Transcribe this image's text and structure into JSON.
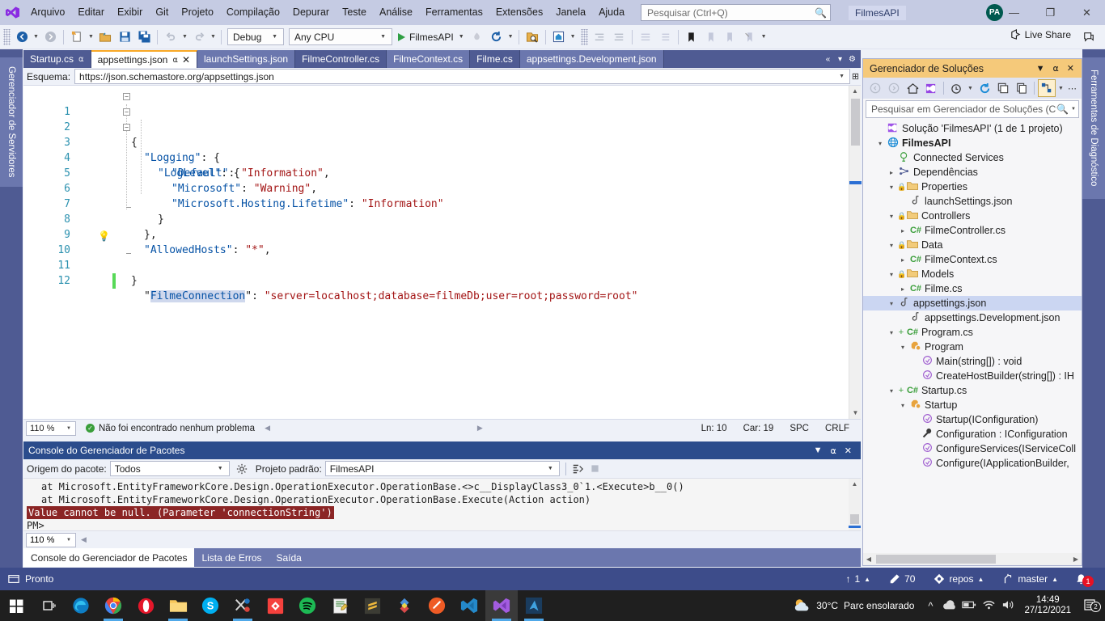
{
  "titlebar": {
    "menus": [
      "Arquivo",
      "Editar",
      "Exibir",
      "Git",
      "Projeto",
      "Compilação",
      "Depurar",
      "Teste",
      "Análise",
      "Ferramentas",
      "Extensões",
      "Janela",
      "Ajuda"
    ],
    "search_placeholder": "Pesquisar (Ctrl+Q)",
    "solution_chip": "FilmesAPI",
    "avatar_initials": "PA",
    "minimize": "—",
    "restore": "❐",
    "close": "✕"
  },
  "toolbar": {
    "config": "Debug",
    "platform": "Any CPU",
    "run_target": "FilmesAPI",
    "live_share": "Live Share"
  },
  "docks": {
    "left_tab": "Gerenciador de Servidores",
    "right_tab": "Ferramentas de Diagnóstico"
  },
  "editor": {
    "tabs": [
      {
        "label": "Startup.cs",
        "state": "inactive",
        "pinned": true
      },
      {
        "label": "appsettings.json",
        "state": "active",
        "pinned": true,
        "closable": true
      },
      {
        "label": "launchSettings.json",
        "state": "inactive2"
      },
      {
        "label": "FilmeController.cs",
        "state": "inactive"
      },
      {
        "label": "FilmeContext.cs",
        "state": "inactive2"
      },
      {
        "label": "Filme.cs",
        "state": "inactive"
      },
      {
        "label": "appsettings.Development.json",
        "state": "inactive2"
      }
    ],
    "schema_label": "Esquema:",
    "schema_value": "https://json.schemastore.org/appsettings.json",
    "lines": [
      {
        "n": "1",
        "indent": 0,
        "fold": "minus",
        "text": "{"
      },
      {
        "n": "2",
        "indent": 1,
        "fold": "minus",
        "text": "\"Logging\": {"
      },
      {
        "n": "3",
        "indent": 2,
        "fold": "minus",
        "text": "\"LogLevel\": {"
      },
      {
        "n": "4",
        "indent": 3,
        "text": "\"Default\": \"Information\","
      },
      {
        "n": "5",
        "indent": 3,
        "text": "\"Microsoft\": \"Warning\","
      },
      {
        "n": "6",
        "indent": 3,
        "text": "\"Microsoft.Hosting.Lifetime\": \"Information\""
      },
      {
        "n": "7",
        "indent": 2,
        "text": "}"
      },
      {
        "n": "8",
        "indent": 1,
        "text": "},"
      },
      {
        "n": "9",
        "indent": 1,
        "text": "\"AllowedHosts\": \"*\","
      },
      {
        "n": "10",
        "indent": 1,
        "text": "\"FilmeConnection\": \"server=localhost;database=filmeDb;user=root;password=root\"",
        "bulb": true,
        "changed": true
      },
      {
        "n": "11",
        "indent": 0,
        "text": "}"
      },
      {
        "n": "12",
        "indent": 0,
        "text": ""
      }
    ],
    "status": {
      "zoom": "110 %",
      "problems": "Não foi encontrado nenhum problema",
      "line": "Ln: 10",
      "col": "Car: 19",
      "spaces": "SPC",
      "eol": "CRLF"
    }
  },
  "package_console": {
    "title": "Console do Gerenciador de Pacotes",
    "source_label": "Origem do pacote:",
    "source_value": "Todos",
    "project_label": "Projeto padrão:",
    "project_value": "FilmesAPI",
    "output": [
      {
        "text": "at Microsoft.EntityFrameworkCore.Design.OperationExecutor.OperationBase.<>c__DisplayClass3_0`1.<Execute>b__0()",
        "type": "normal"
      },
      {
        "text": "at Microsoft.EntityFrameworkCore.Design.OperationExecutor.OperationBase.Execute(Action action)",
        "type": "normal"
      },
      {
        "text": "Value cannot be null. (Parameter 'connectionString')",
        "type": "error"
      },
      {
        "text": "PM>",
        "type": "prompt"
      }
    ],
    "zoom": "110 %",
    "tabs": [
      {
        "label": "Console do Gerenciador de Pacotes",
        "active": true
      },
      {
        "label": "Lista de Erros",
        "active": false
      },
      {
        "label": "Saída",
        "active": false
      }
    ]
  },
  "solution_explorer": {
    "title": "Gerenciador de Soluções",
    "search_placeholder": "Pesquisar em Gerenciador de Soluções (Ctrl",
    "tree": [
      {
        "indent": 0,
        "twisty": "",
        "icon": "solution",
        "label": "Solução 'FilmesAPI' (1 de 1 projeto)"
      },
      {
        "indent": 0,
        "twisty": "open",
        "icon": "project",
        "label": "FilmesAPI",
        "bold": true
      },
      {
        "indent": 1,
        "twisty": "",
        "icon": "services",
        "label": "Connected Services"
      },
      {
        "indent": 1,
        "twisty": "closed",
        "icon": "deps",
        "label": "Dependências"
      },
      {
        "indent": 1,
        "twisty": "open",
        "icon": "folder",
        "label": "Properties",
        "lock": true
      },
      {
        "indent": 2,
        "twisty": "",
        "icon": "json",
        "label": "launchSettings.json"
      },
      {
        "indent": 1,
        "twisty": "open",
        "icon": "folder",
        "label": "Controllers",
        "lock": true
      },
      {
        "indent": 2,
        "twisty": "closed",
        "icon": "cs",
        "label": "FilmeController.cs"
      },
      {
        "indent": 1,
        "twisty": "open",
        "icon": "folder",
        "label": "Data",
        "lock": true
      },
      {
        "indent": 2,
        "twisty": "closed",
        "icon": "cs",
        "label": "FilmeContext.cs"
      },
      {
        "indent": 1,
        "twisty": "open",
        "icon": "folder",
        "label": "Models",
        "lock": true
      },
      {
        "indent": 2,
        "twisty": "closed",
        "icon": "cs",
        "label": "Filme.cs"
      },
      {
        "indent": 1,
        "twisty": "open",
        "icon": "json",
        "label": "appsettings.json",
        "selected": true
      },
      {
        "indent": 2,
        "twisty": "",
        "icon": "json",
        "label": "appsettings.Development.json"
      },
      {
        "indent": 1,
        "twisty": "open",
        "icon": "cs",
        "label": "Program.cs",
        "plus": true
      },
      {
        "indent": 2,
        "twisty": "open",
        "icon": "class",
        "label": "Program"
      },
      {
        "indent": 3,
        "twisty": "",
        "icon": "method",
        "label": "Main(string[]) : void"
      },
      {
        "indent": 3,
        "twisty": "",
        "icon": "method",
        "label": "CreateHostBuilder(string[]) : IH"
      },
      {
        "indent": 1,
        "twisty": "open",
        "icon": "cs",
        "label": "Startup.cs",
        "plus": true
      },
      {
        "indent": 2,
        "twisty": "open",
        "icon": "class",
        "label": "Startup"
      },
      {
        "indent": 3,
        "twisty": "",
        "icon": "method",
        "label": "Startup(IConfiguration)"
      },
      {
        "indent": 3,
        "twisty": "",
        "icon": "prop",
        "label": "Configuration : IConfiguration"
      },
      {
        "indent": 3,
        "twisty": "",
        "icon": "method",
        "label": "ConfigureServices(IServiceColl"
      },
      {
        "indent": 3,
        "twisty": "",
        "icon": "method",
        "label": "Configure(IApplicationBuilder,"
      }
    ]
  },
  "vs_status": {
    "ready": "Pronto",
    "pending_count": "1",
    "edits": "70",
    "repo": "repos",
    "branch": "master",
    "notifications": "1"
  },
  "taskbar": {
    "apps": [
      {
        "name": "start-button"
      },
      {
        "name": "task-view-button"
      },
      {
        "name": "edge",
        "running": false
      },
      {
        "name": "chrome",
        "running": true
      },
      {
        "name": "opera",
        "running": false
      },
      {
        "name": "file-explorer",
        "running": true
      },
      {
        "name": "skype",
        "running": false
      },
      {
        "name": "snipping-tool",
        "running": true
      },
      {
        "name": "beekeeper",
        "running": false
      },
      {
        "name": "spotify",
        "running": false
      },
      {
        "name": "notepad",
        "running": false
      },
      {
        "name": "sublime",
        "running": false
      },
      {
        "name": "mysql-workbench",
        "running": false
      },
      {
        "name": "postman",
        "running": false
      },
      {
        "name": "vscode",
        "running": false
      },
      {
        "name": "visual-studio",
        "running": true,
        "active": true
      },
      {
        "name": "azure-data-studio",
        "running": true
      }
    ],
    "weather_temp": "30°C",
    "weather_desc": "Parc ensolarado",
    "time": "14:49",
    "date": "27/12/2021",
    "notification_count": "2"
  }
}
